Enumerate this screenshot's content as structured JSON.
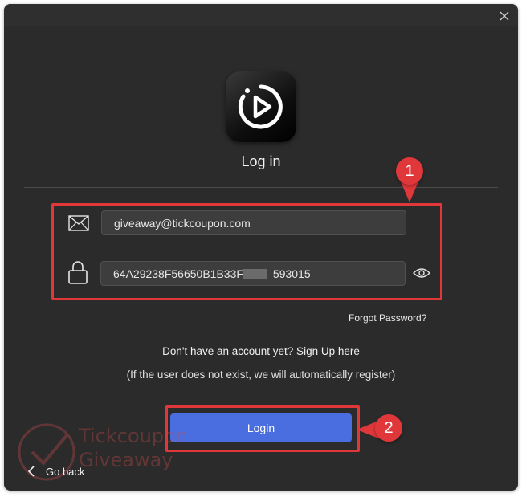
{
  "dialog": {
    "heading": "Log in"
  },
  "form": {
    "email_value": "giveaway@tickcoupon.com",
    "password_value_left": "64A29238F56650B1B33F",
    "password_value_right": "593015",
    "forgot_label": "Forgot Password?"
  },
  "signup": {
    "prompt": "Don't have an account yet? Sign Up here",
    "note": "(If the user does not exist, we will automatically register)"
  },
  "actions": {
    "login_label": "Login",
    "go_back_label": "Go back"
  },
  "annotations": {
    "badge_1": "1",
    "badge_2": "2"
  },
  "watermark": {
    "line1": "Tickcoupon",
    "line2": "Giveaway"
  },
  "icons": [
    "close-icon",
    "app-logo-play-icon",
    "mail-icon",
    "lock-icon",
    "eye-icon",
    "chevron-left-icon"
  ],
  "colors": {
    "background": "#2b2b2b",
    "field": "#3d3d3d",
    "accent": "#4a6ee0",
    "annotation": "#e0373b"
  }
}
